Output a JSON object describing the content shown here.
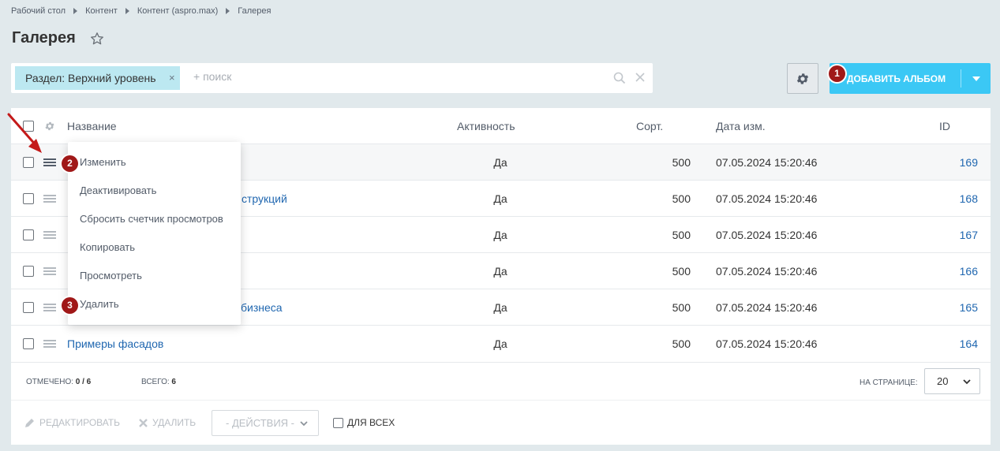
{
  "breadcrumb": [
    "Рабочий стол",
    "Контент",
    "Контент (aspro.max)",
    "Галерея"
  ],
  "page_title": "Галерея",
  "filter": {
    "tag_label": "Раздел: Верхний уровень",
    "tag_close": "×",
    "search_placeholder": "+ поиск"
  },
  "add_button": {
    "label": "ДОБАВИТЬ АЛЬБОМ"
  },
  "badges": [
    "1",
    "2",
    "3"
  ],
  "columns": {
    "name": "Название",
    "activity": "Активность",
    "sort": "Сорт.",
    "date": "Дата изм.",
    "id": "ID"
  },
  "rows": [
    {
      "name": "",
      "activity": "Да",
      "sort": "500",
      "date": "07.05.2024 15:20:46",
      "id": "169"
    },
    {
      "name": "струкций",
      "activity": "Да",
      "sort": "500",
      "date": "07.05.2024 15:20:46",
      "id": "168"
    },
    {
      "name": "",
      "activity": "Да",
      "sort": "500",
      "date": "07.05.2024 15:20:46",
      "id": "167"
    },
    {
      "name": "",
      "activity": "Да",
      "sort": "500",
      "date": "07.05.2024 15:20:46",
      "id": "166"
    },
    {
      "name": "бизнеса",
      "activity": "Да",
      "sort": "500",
      "date": "07.05.2024 15:20:46",
      "id": "165"
    },
    {
      "name": "Примеры фасадов",
      "activity": "Да",
      "sort": "500",
      "date": "07.05.2024 15:20:46",
      "id": "164"
    }
  ],
  "context_menu": [
    "Изменить",
    "Деактивировать",
    "Сбросить счетчик просмотров",
    "Копировать",
    "Просмотреть",
    "Удалить"
  ],
  "footer": {
    "checked_label": "ОТМЕЧЕНО:",
    "checked_value": "0 / 6",
    "total_label": "ВСЕГО:",
    "total_value": "6",
    "per_page_label": "НА СТРАНИЦЕ:",
    "per_page_value": "20"
  },
  "actions": {
    "edit": "РЕДАКТИРОВАТЬ",
    "delete": "УДАЛИТЬ",
    "select": "- ДЕЙСТВИЯ -",
    "for_all": "ДЛЯ ВСЕХ"
  },
  "colors": {
    "accent": "#3bc8f5",
    "link": "#2067b0",
    "badge": "#a01818",
    "filter_tag": "#bce8f1"
  }
}
